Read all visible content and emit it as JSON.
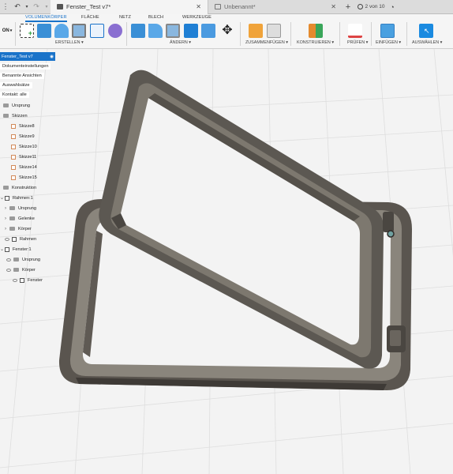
{
  "window": {
    "active_tab": "Fenster_Test v7*",
    "inactive_tab": "Unbenannt*",
    "doc_count": "2 von 10"
  },
  "ribbon": {
    "tabs": [
      "VOLUMENKÖRPER",
      "FLÄCHE",
      "NETZ",
      "BLECH",
      "WERKZEUGE"
    ],
    "active_tab": "VOLUMENKÖRPER",
    "left_label": "ON",
    "groups": [
      "ERSTELLEN",
      "ÄNDERN",
      "ZUSAMMENFÜGEN",
      "KONSTRUIEREN",
      "PRÜFEN",
      "EINFÜGEN",
      "AUSWÄHLEN"
    ]
  },
  "browser": {
    "root": "Fenster_Test v7",
    "items": [
      "Dokumenteinstellungen",
      "Benannte Ansichten",
      "Auswahlsätze",
      "Kontakt: alle",
      "Ursprung",
      "Skizzen",
      "Skizze8",
      "Skizze9",
      "Skizze10",
      "Skizze11",
      "Skizze14",
      "Skizze15",
      "Konstruktion",
      "Rahmen:1",
      "Ursprung",
      "Gelenke",
      "Körper",
      "Rahmen",
      "Fenster:1",
      "Ursprung",
      "Körper",
      "Fenster"
    ]
  },
  "colors": {
    "accent": "#1a73c9",
    "model_dark": "#4e4a45",
    "model_mid": "#7a756d",
    "grid": "#e2e2e2"
  }
}
